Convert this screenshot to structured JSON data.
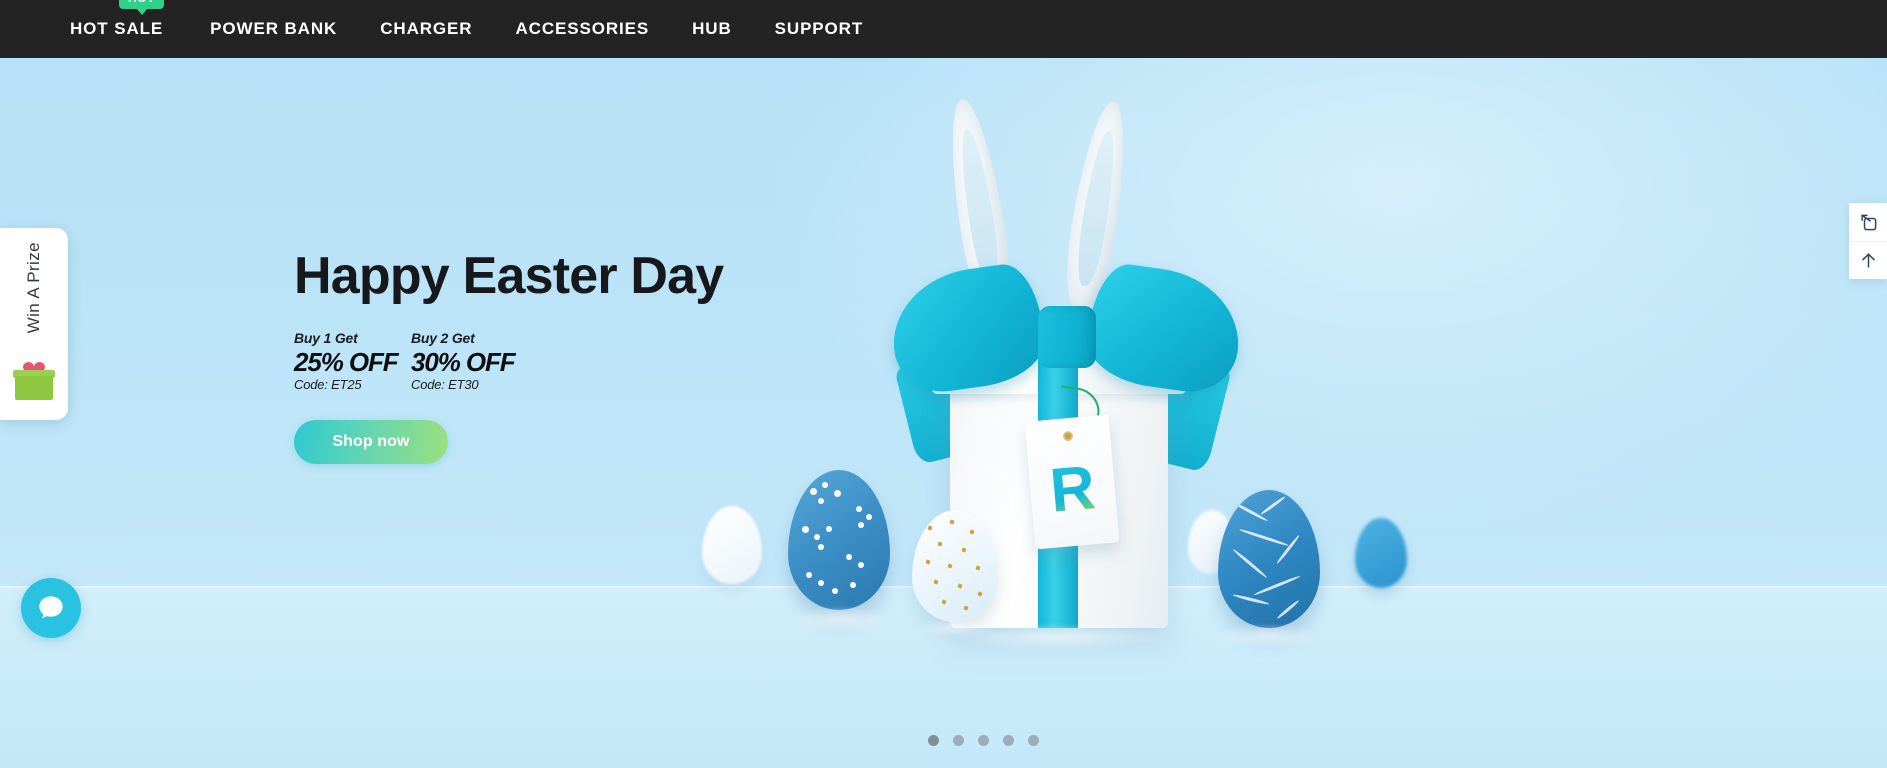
{
  "nav": {
    "items": [
      {
        "label": "HOT SALE",
        "badge": "HOT"
      },
      {
        "label": "POWER BANK",
        "badge": null
      },
      {
        "label": "CHARGER",
        "badge": null
      },
      {
        "label": "ACCESSORIES",
        "badge": null
      },
      {
        "label": "HUB",
        "badge": null
      },
      {
        "label": "SUPPORT",
        "badge": null
      }
    ],
    "background_color": "#232323",
    "badge_color": "#2fd08a"
  },
  "hero": {
    "title": "Happy Easter Day",
    "background_color": "#bde4f7",
    "offers": [
      {
        "prefix": "Buy 1 Get",
        "discount": "25% OFF",
        "code": "Code: ET25"
      },
      {
        "prefix": "Buy 2 Get",
        "discount": "30% OFF",
        "code": "Code: ET30"
      }
    ],
    "cta": {
      "label": "Shop now",
      "gradient_from": "#2fc9cf",
      "gradient_to": "#9ae07f"
    },
    "gift_tag_letter": "R"
  },
  "prize_widget": {
    "label": "Win A Prize",
    "icon": "gift-icon"
  },
  "side_tools": {
    "buttons": [
      {
        "icon": "share-expand-icon"
      },
      {
        "icon": "scroll-to-top-icon"
      }
    ]
  },
  "chat": {
    "icon": "chat-bubble-icon",
    "color": "#29c2e0"
  },
  "carousel": {
    "slide_count": 5,
    "active_index": 0,
    "dots": [
      "1",
      "2",
      "3",
      "4",
      "5"
    ]
  }
}
